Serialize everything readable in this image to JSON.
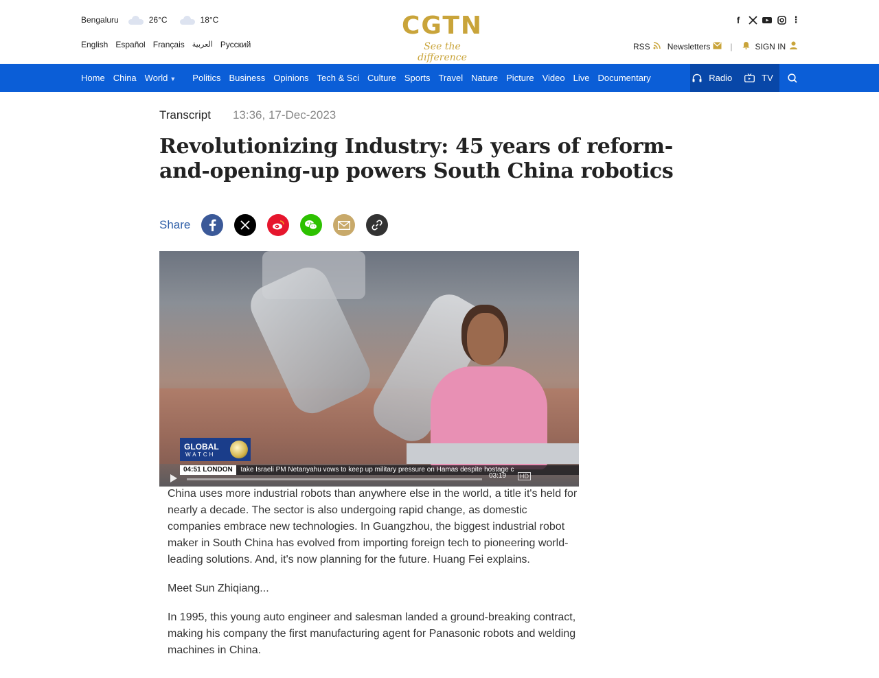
{
  "header": {
    "weather": {
      "city": "Bengaluru",
      "high": "26°C",
      "low": "18°C",
      "icon": "cloud-icon"
    },
    "languages": [
      "English",
      "Español",
      "Français",
      "العربية",
      "Русский"
    ],
    "logo": {
      "mark": "CGTN",
      "tagline": "See the difference",
      "color": "#c9a43a"
    },
    "social": [
      "facebook-icon",
      "x-icon",
      "youtube-icon",
      "instagram-icon",
      "more-icon"
    ],
    "rss_label": "RSS",
    "newsletters_label": "Newsletters",
    "signin_label": "SIGN IN"
  },
  "nav": {
    "items": [
      "Home",
      "China",
      "World",
      "Politics",
      "Business",
      "Opinions",
      "Tech & Sci",
      "Culture",
      "Sports",
      "Travel",
      "Nature",
      "Picture",
      "Video",
      "Live",
      "Documentary"
    ],
    "radio_label": "Radio",
    "tv_label": "TV",
    "accent": "#0b5ed7"
  },
  "article": {
    "category": "Transcript",
    "date": "13:36, 17-Dec-2023",
    "title": "Revolutionizing Industry: 45 years of reform-and-opening-up powers South China robotics",
    "share_label": "Share",
    "share_buttons": [
      {
        "name": "facebook",
        "color": "#3b5998",
        "glyph": "f"
      },
      {
        "name": "x",
        "color": "#000000",
        "glyph": "𝕏"
      },
      {
        "name": "weibo",
        "color": "#e6162d",
        "glyph": "微"
      },
      {
        "name": "wechat",
        "color": "#2dc100",
        "glyph": "微"
      },
      {
        "name": "email",
        "color": "#c8a96a",
        "glyph": "✉"
      },
      {
        "name": "link",
        "color": "#333333",
        "glyph": "⛓"
      }
    ],
    "video": {
      "badge_title": "GLOBAL",
      "badge_sub": "WATCH",
      "clock": "04:51",
      "city": "LONDON",
      "ticker": "take      Israeli PM Netanyahu vows to keep up military pressure on Hamas despite hostage c",
      "duration": "03:19",
      "elapsed": "00:00",
      "hd_label": "HD"
    },
    "paragraphs": [
      "China uses more industrial robots than anywhere else in the world, a title it's held for nearly a decade. The sector is also undergoing rapid change, as domestic companies embrace new technologies. In Guangzhou, the biggest industrial robot maker in South China has evolved from importing foreign tech to pioneering world-leading solutions. And, it's now planning for the future. Huang Fei explains.",
      "Meet Sun Zhiqiang...",
      "In 1995, this young auto engineer and salesman landed a ground-breaking contract, making his company the first manufacturing agent for Panasonic robots and welding machines in China."
    ]
  }
}
